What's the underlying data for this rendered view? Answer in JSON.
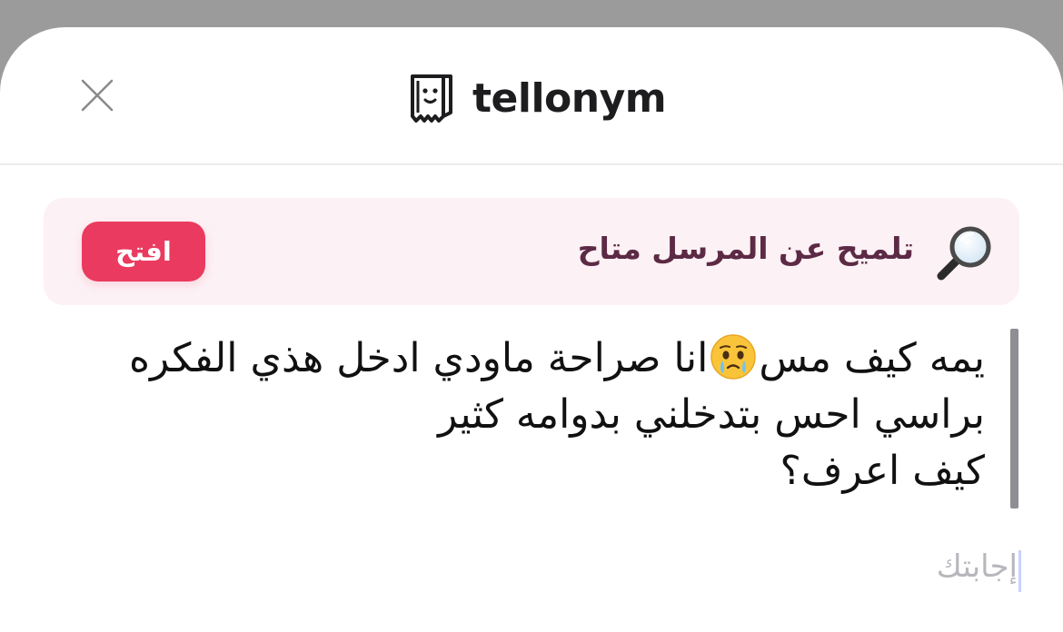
{
  "header": {
    "brand_name": "tellonym",
    "close_icon": "close-icon",
    "logo_icon": "tellonym-logo-icon"
  },
  "hint": {
    "text": "تلميح عن المرسل متاح",
    "icon": "magnifying-glass-icon",
    "open_label": "افتح"
  },
  "question": {
    "line1_before_emoji": "يمه كيف مس",
    "emoji": "face-holding-back-tears-emoji",
    "line1_after_emoji": "انا صراحة ماودي ادخل هذي الفكره",
    "line2": "براسي احس بتدخلني بدوامه كثير",
    "line3": "كيف اعرف؟"
  },
  "answer": {
    "placeholder": "إجابتك",
    "value": ""
  },
  "colors": {
    "accent": "#eb3a5f",
    "hint_background": "#fcf1f5",
    "hint_text": "#5c2a44",
    "quote_bar": "#8e8e93"
  }
}
